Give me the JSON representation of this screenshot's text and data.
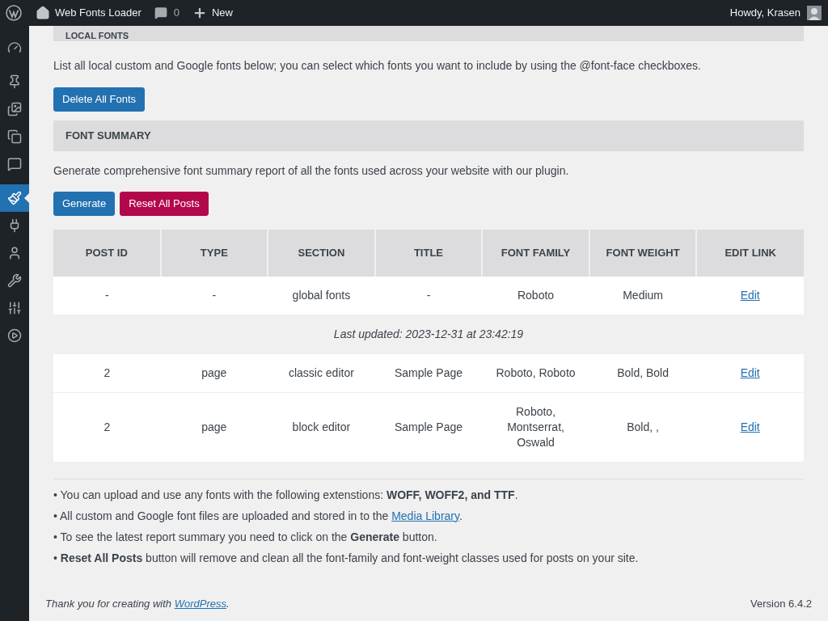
{
  "admin_bar": {
    "site_name": "Web Fonts Loader",
    "comments_count": "0",
    "new_label": "New",
    "greeting": "Howdy, Krasen"
  },
  "sidebar": {
    "items": [
      {
        "kind": "dashboard",
        "selected": false
      },
      {
        "kind": "pin",
        "selected": false
      },
      {
        "kind": "media",
        "selected": false
      },
      {
        "kind": "pages",
        "selected": false
      },
      {
        "kind": "comments",
        "selected": false
      },
      {
        "kind": "brush",
        "selected": true
      },
      {
        "kind": "plugins",
        "selected": false
      },
      {
        "kind": "users",
        "selected": false
      },
      {
        "kind": "tools",
        "selected": false
      },
      {
        "kind": "settings",
        "selected": false
      },
      {
        "kind": "play",
        "selected": false
      }
    ]
  },
  "local_fonts": {
    "heading": "LOCAL FONTS",
    "description": "List all local custom and Google fonts below; you can select which fonts you want to include by using the @font-face checkboxes.",
    "buttons": [
      {
        "label": "Delete All Fonts",
        "kind": "primary"
      }
    ]
  },
  "font_summary": {
    "heading": "FONT SUMMARY",
    "description": "Generate comprehensive font summary report of all the fonts used across your website with our plugin.",
    "buttons": [
      {
        "label": "Generate",
        "kind": "primary"
      },
      {
        "label": "Reset All Posts",
        "kind": "danger"
      }
    ]
  },
  "table": {
    "columns": [
      "POST ID",
      "TYPE",
      "SECTION",
      "TITLE",
      "FONT FAMILY",
      "FONT WEIGHT",
      "EDIT LINK"
    ],
    "rows": [
      {
        "kind": "row",
        "cells": [
          "-",
          "-",
          "global fonts",
          "-",
          "Roboto",
          "Medium"
        ],
        "link": "Edit"
      },
      {
        "kind": "note",
        "text": "Last updated: 2023-12-31 at 23:42:19"
      },
      {
        "kind": "row",
        "cells": [
          "2",
          "page",
          "classic editor",
          "Sample Page",
          "Roboto, Roboto",
          "Bold, Bold"
        ],
        "link": "Edit"
      },
      {
        "kind": "row",
        "cells": [
          "2",
          "page",
          "block editor",
          "Sample Page",
          "Roboto, Montserrat, Oswald",
          "Bold, ,"
        ],
        "link": "Edit"
      }
    ]
  },
  "notes": [
    [
      {
        "kind": "text",
        "text": "• You can upload and use any fonts with the following extenstions: **WOFF, WOFF2, and TTF**."
      }
    ],
    [
      {
        "kind": "text",
        "text": "• All custom and Google font files are uploaded and stored in to the "
      },
      {
        "kind": "link",
        "text": "Media Library"
      },
      {
        "kind": "text",
        "text": "."
      }
    ],
    [
      {
        "kind": "text",
        "text": "• To see the latest report summary you need to click on the **Generate** button."
      }
    ],
    [
      {
        "kind": "text",
        "text": "• **Reset All Posts** button will remove and clean all the font-family and font-weight classes used for posts on your site."
      }
    ]
  ],
  "footer": {
    "thanks": [
      {
        "kind": "text",
        "text": "Thank you for creating with "
      },
      {
        "kind": "link",
        "text": "WordPress"
      },
      {
        "kind": "text",
        "text": "."
      }
    ],
    "version": "Version 6.4.2"
  }
}
